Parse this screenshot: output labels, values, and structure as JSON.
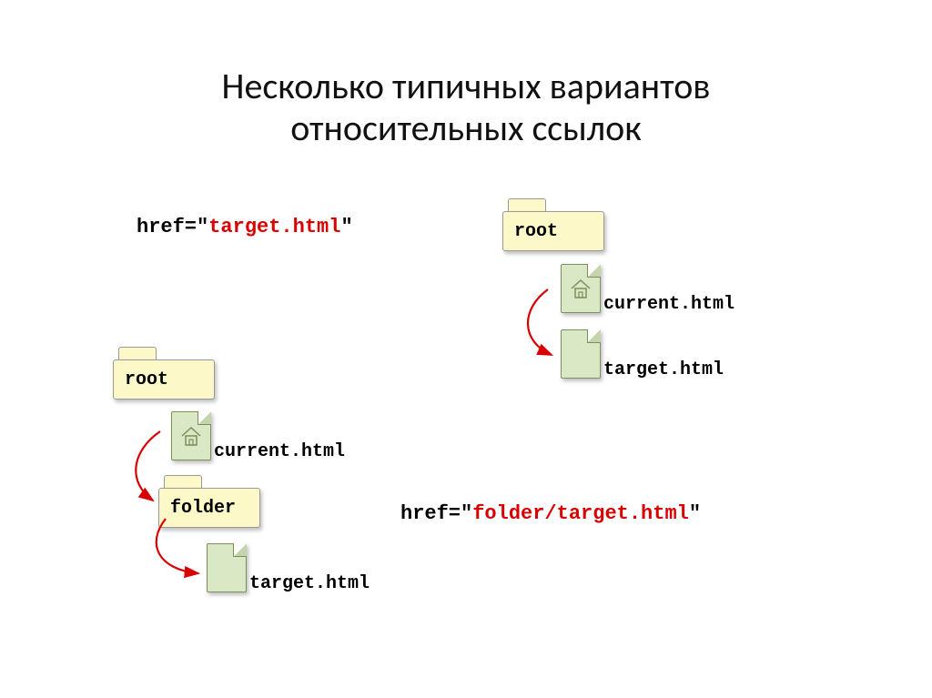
{
  "title_line1": "Несколько типичных вариантов",
  "title_line2": "относительных ссылок",
  "href1_prefix": "href=\"",
  "href1_value": "target.html",
  "href1_suffix": "\"",
  "href2_prefix": "href=\"",
  "href2_value": "folder/target.html",
  "href2_suffix": "\"",
  "folder_root": "root",
  "folder_folder": "folder",
  "file_current": "current.html",
  "file_target": "target.html"
}
